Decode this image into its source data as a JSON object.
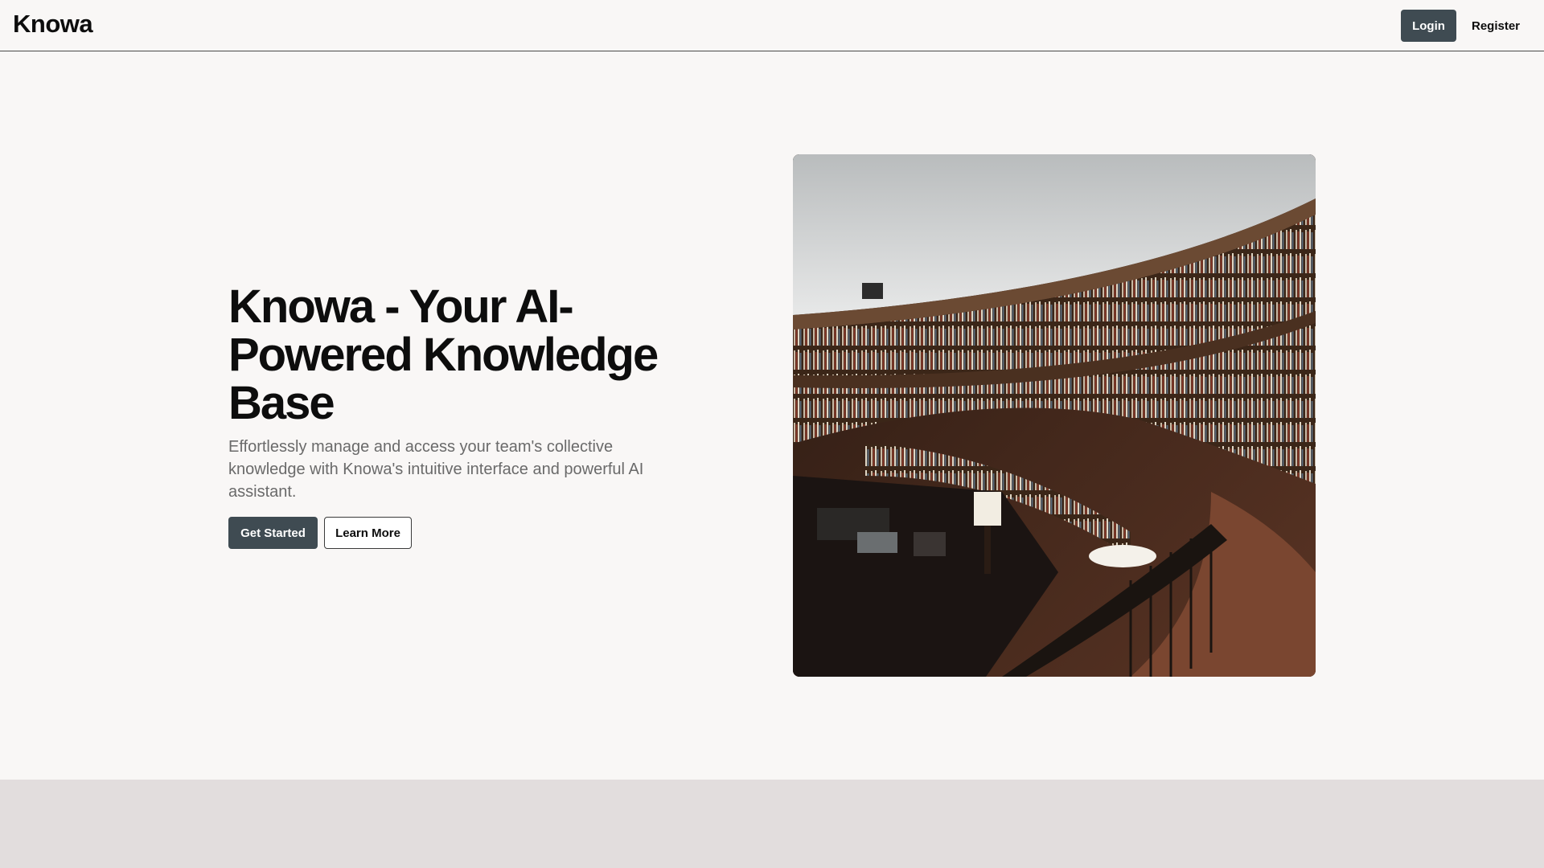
{
  "header": {
    "brand": "Knowa",
    "login_label": "Login",
    "register_label": "Register"
  },
  "hero": {
    "title": "Knowa - Your AI-Powered Knowledge Base",
    "subtitle": "Effortlessly manage and access your team's collective knowledge with Knowa's intuitive interface and powerful AI assistant.",
    "primary_cta": "Get Started",
    "secondary_cta": "Learn More"
  },
  "colors": {
    "page_bg": "#f9f7f6",
    "primary_button": "#3f4b52",
    "lower_band": "#e2dddd"
  }
}
